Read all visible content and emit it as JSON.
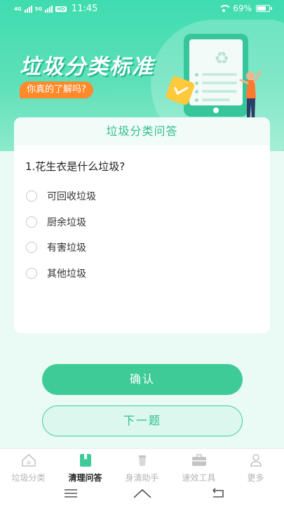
{
  "status_bar": {
    "network_1": "4G",
    "network_2": "5G",
    "hd": "HD",
    "time": "11:45",
    "battery": "69%"
  },
  "banner": {
    "title": "垃圾分类标准",
    "subtitle": "你真的了解吗?"
  },
  "quiz": {
    "header": "垃圾分类问答",
    "question": "1.花生衣是什么垃圾?",
    "options": [
      "可回收垃圾",
      "厨余垃圾",
      "有害垃圾",
      "其他垃圾"
    ]
  },
  "actions": {
    "confirm_label": "确认",
    "next_label": "下一题"
  },
  "tabbar": {
    "items": [
      {
        "label": "垃圾分类",
        "icon": "house-recycle-icon"
      },
      {
        "label": "清理问答",
        "icon": "book-icon"
      },
      {
        "label": "身清助手",
        "icon": "cup-icon"
      },
      {
        "label": "速效工具",
        "icon": "toolbox-icon"
      },
      {
        "label": "更多",
        "icon": "person-icon"
      }
    ],
    "active_index": 1
  },
  "colors": {
    "primary": "#3ecb98",
    "primary_text": "#2fbd8e",
    "accent": "#ff8a2b",
    "background": "#eafaf4"
  }
}
